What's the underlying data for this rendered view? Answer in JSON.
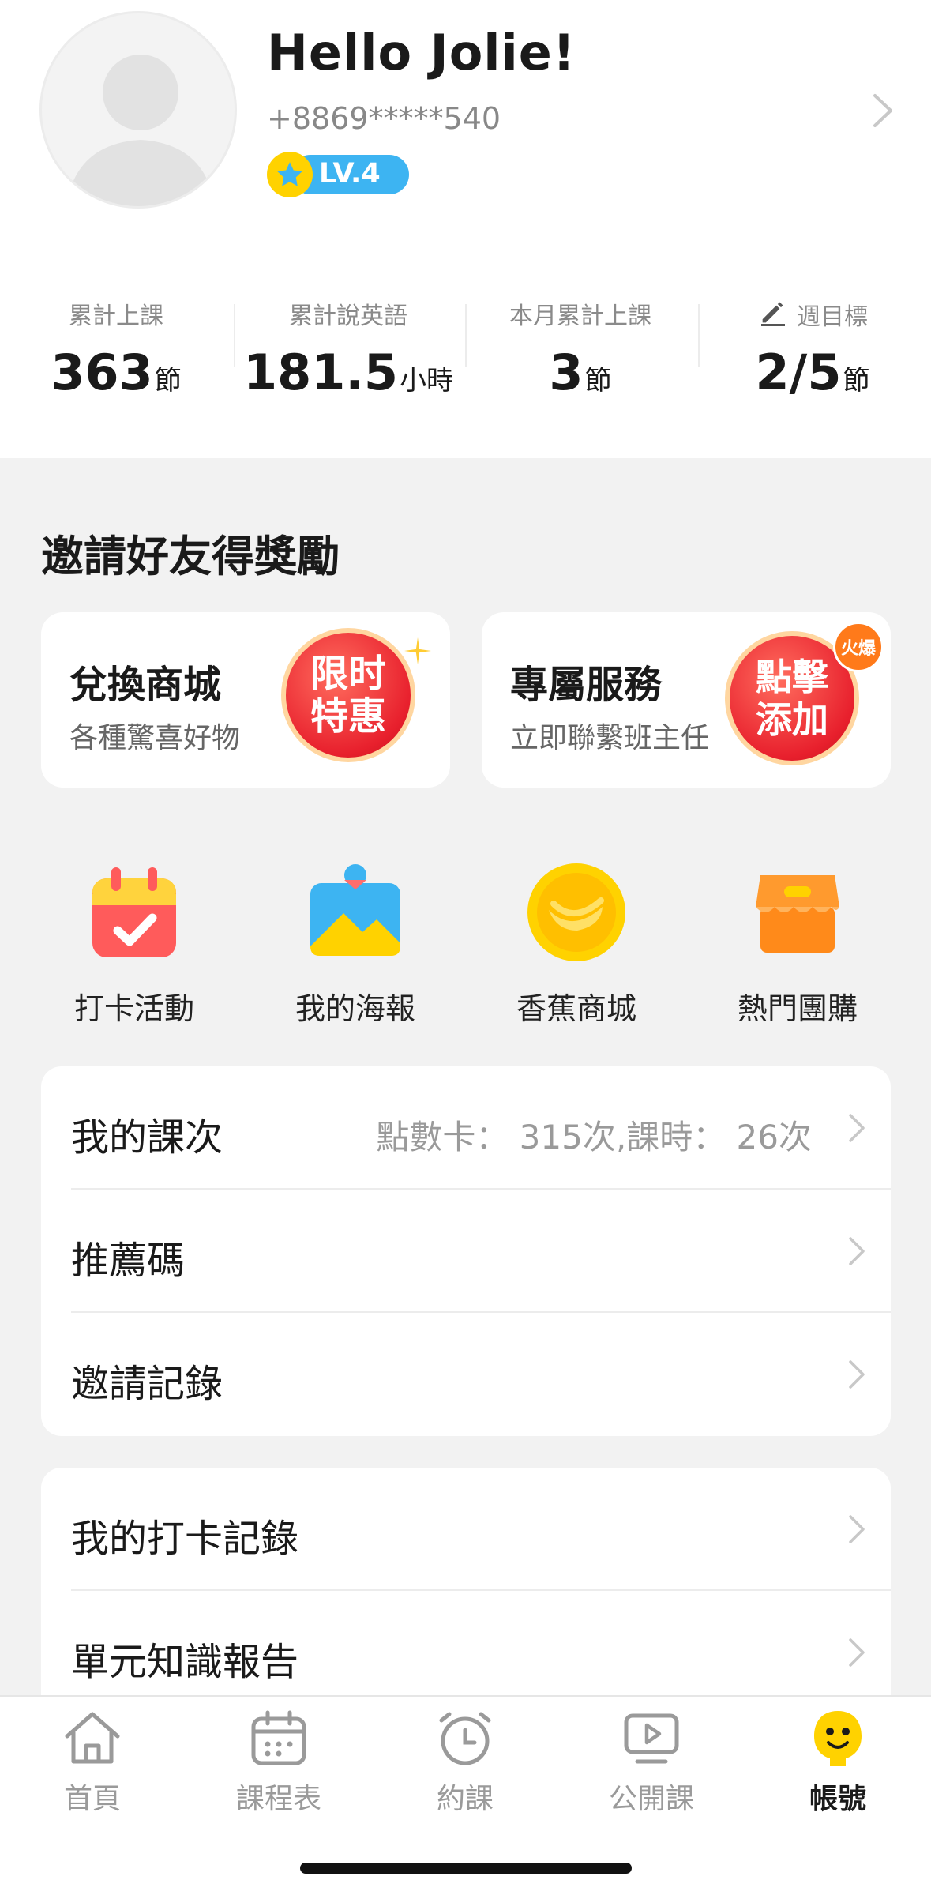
{
  "profile": {
    "greeting": "Hello Jolie!",
    "phone": "+8869*****540",
    "level": "LV.4"
  },
  "stats": [
    {
      "label": "累計上課",
      "value": "363",
      "unit": "節"
    },
    {
      "label": "累計說英語",
      "value": "181.5",
      "unit": "小時"
    },
    {
      "label": "本月累計上課",
      "value": "3",
      "unit": "節"
    },
    {
      "label": "週目標",
      "value": "2/5",
      "unit": "節",
      "icon": "pencil-icon"
    }
  ],
  "invite": {
    "title": "邀請好友得獎勵",
    "cards": [
      {
        "title": "兌換商城",
        "subtitle": "各種驚喜好物",
        "badge": "限时特惠"
      },
      {
        "title": "專屬服務",
        "subtitle": "立即聯繫班主任",
        "badge": "點擊添加",
        "hot_tag": "火爆"
      }
    ]
  },
  "quick_actions": [
    {
      "label": "打卡活動",
      "icon": "calendar-check-icon"
    },
    {
      "label": "我的海報",
      "icon": "poster-image-icon"
    },
    {
      "label": "香蕉商城",
      "icon": "banana-coin-icon"
    },
    {
      "label": "熱門團購",
      "icon": "shop-icon"
    }
  ],
  "list1": [
    {
      "label": "我的課次",
      "value": "點數卡：  315次,課時：  26次"
    },
    {
      "label": "推薦碼",
      "value": ""
    },
    {
      "label": "邀請記錄",
      "value": ""
    }
  ],
  "list2": [
    {
      "label": "我的打卡記錄",
      "value": ""
    },
    {
      "label": "單元知識報告",
      "value": ""
    }
  ],
  "tabs": [
    {
      "label": "首頁",
      "icon": "home-icon"
    },
    {
      "label": "課程表",
      "icon": "schedule-icon"
    },
    {
      "label": "約課",
      "icon": "alarm-clock-icon"
    },
    {
      "label": "公開課",
      "icon": "video-play-icon"
    },
    {
      "label": "帳號",
      "icon": "account-smile-icon",
      "active": true
    }
  ],
  "colors": {
    "accent_yellow": "#ffd200",
    "level_blue": "#3db4f2",
    "badge_red": "#e8202d",
    "background": "#f2f2f2"
  }
}
